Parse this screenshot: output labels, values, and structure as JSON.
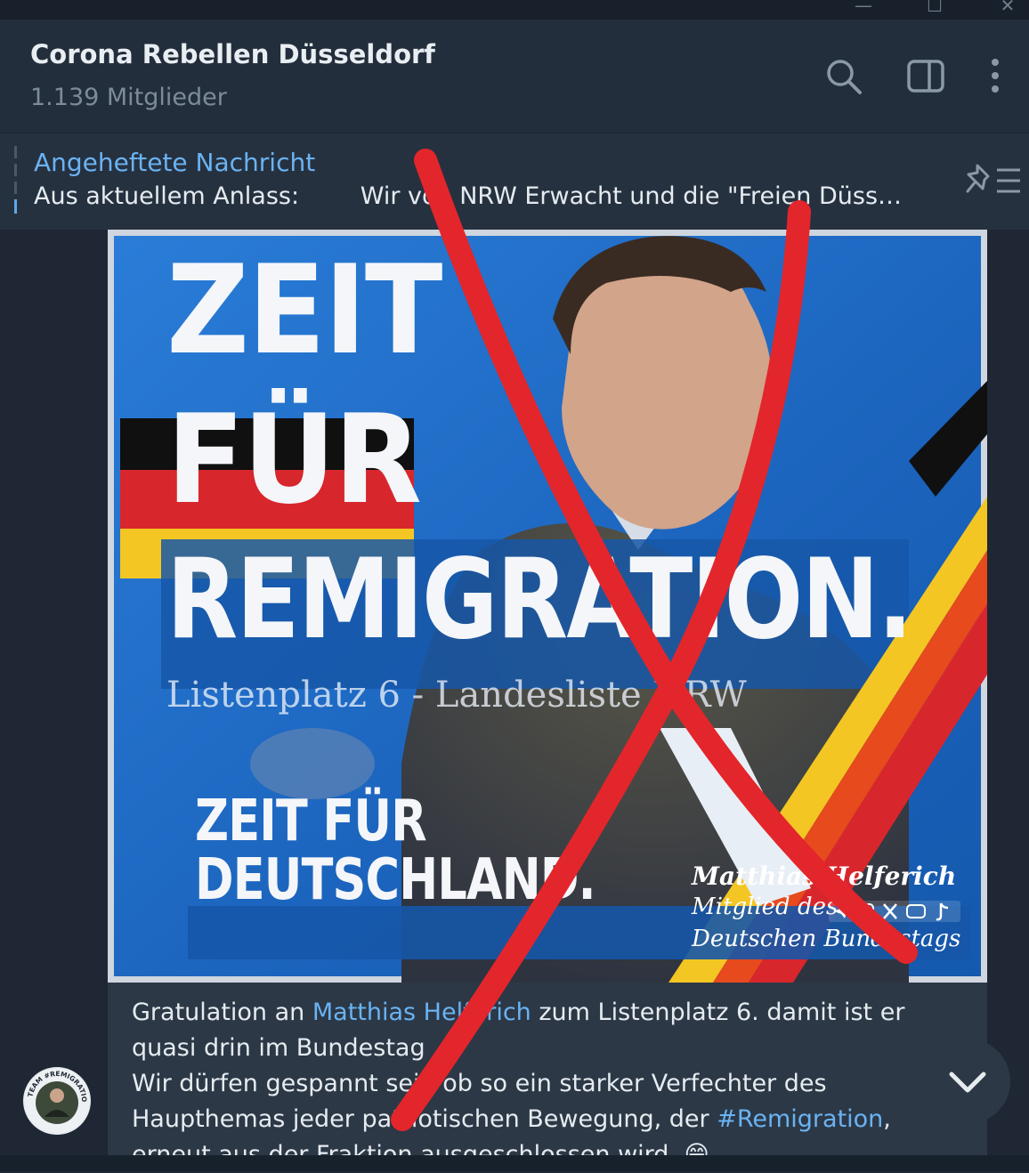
{
  "window": {
    "controls": {
      "minimize": "—",
      "maximize": "☐",
      "close": "✕"
    }
  },
  "header": {
    "title": "Corona Rebellen Düsseldorf",
    "subtitle": "1.139 Mitglieder",
    "icons": [
      "search-icon",
      "sidebar-toggle-icon",
      "more-vertical-icon"
    ]
  },
  "pinned": {
    "title": "Angeheftete Nachricht",
    "text": "Aus aktuellem Anlass:        Wir von NRW Erwacht und die \"Freien Düss…",
    "icon": "unpin-list-icon"
  },
  "poster": {
    "headline_1": "ZEIT",
    "headline_2": "FÜR",
    "headline_3": "REMIGRATION.",
    "listenplatz": "Listenplatz 6 - Landesliste NRW",
    "slogan_1": "ZEIT FÜR",
    "slogan_2": "DEUTSCHLAND.",
    "name": "Matthias Helferich",
    "role_1": "Mitglied des",
    "role_2": "Deutschen Bundestags",
    "social_icons": [
      "telegram-icon",
      "instagram-icon",
      "x-icon",
      "youtube-icon",
      "tiktok-icon"
    ]
  },
  "caption": {
    "l1_pre": "Gratulation an ",
    "l1_link": "Matthias Helferich",
    "l1_post": " zum Listenplatz 6. damit ist er",
    "l2": "quasi drin im Bundestag 👌",
    "l3": "Wir dürfen gespannt sein ob so ein starker Verfechter des",
    "l4_pre": "Haupthemas jeder patriotischen Bewegung, der ",
    "l4_link": "#Remigration",
    "l4_post": ",",
    "l5": "erneut aus der Fraktion ausgeschlossen wird. 😁"
  },
  "avatar": {
    "ring_text": "TEAM #REMIGRATION"
  },
  "colors": {
    "app_bg": "#1e2733",
    "header_bg": "#232e3c",
    "link": "#6ab3f3",
    "poster_blue": "#1f6bc4",
    "strike_red": "#e3262b"
  }
}
